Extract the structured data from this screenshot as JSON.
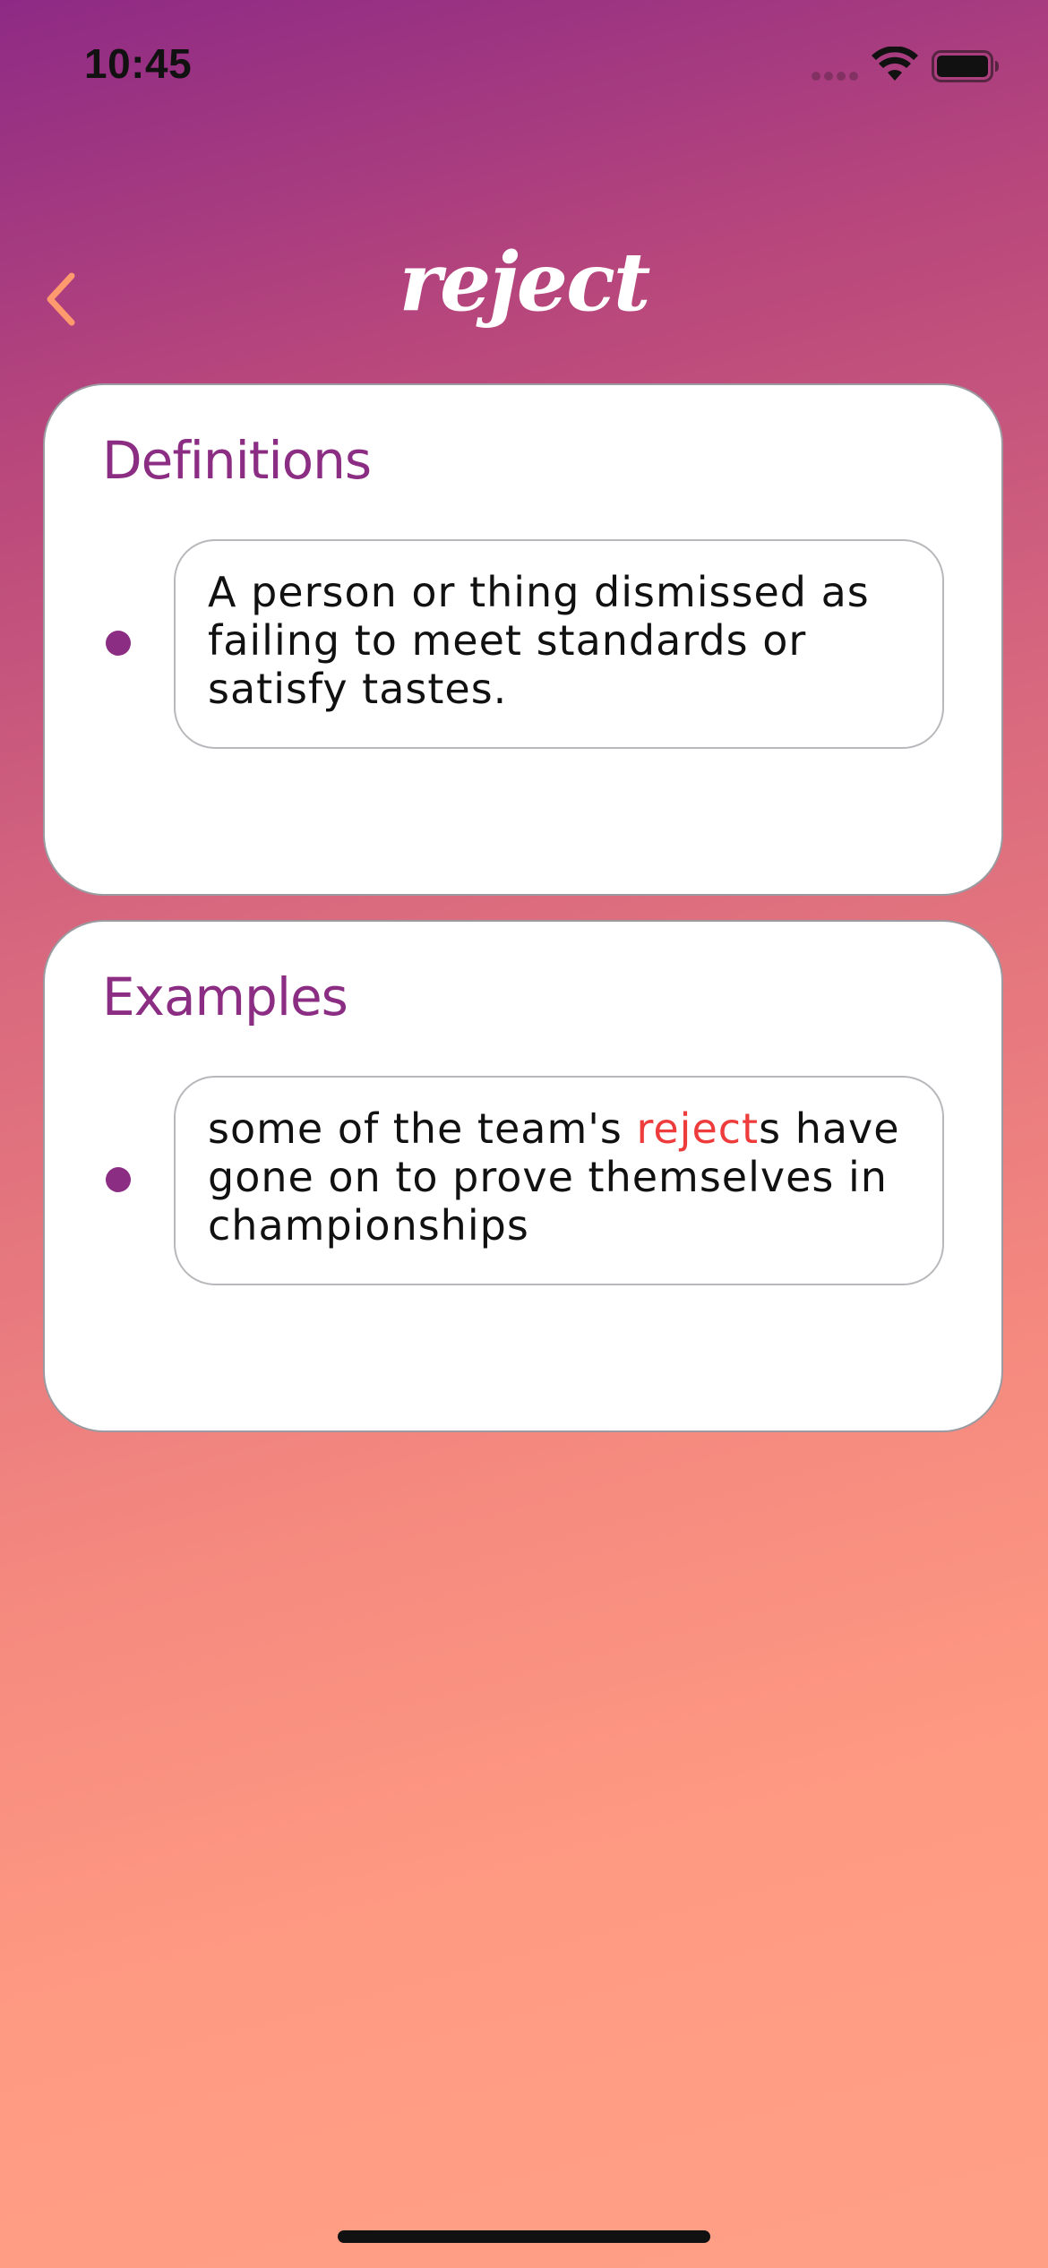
{
  "status_bar": {
    "time": "10:45"
  },
  "header": {
    "title": "reject",
    "back_icon": "chevron-left-icon",
    "back_color": "#ff9a6e"
  },
  "definitions": {
    "heading": "Definitions",
    "items": [
      {
        "text": "A person or thing dismissed as failing to meet standards or satisfy tastes."
      }
    ]
  },
  "examples": {
    "heading": "Examples",
    "items": [
      {
        "before": "some of the team's ",
        "highlight": "reject",
        "after": "s have gone on to prove themselves in championships"
      }
    ]
  },
  "colors": {
    "accent_purple": "#8c2d84",
    "highlight_red": "#ee3b3b",
    "gradient_top": "#8e2a85",
    "gradient_bottom": "#ffa086"
  }
}
